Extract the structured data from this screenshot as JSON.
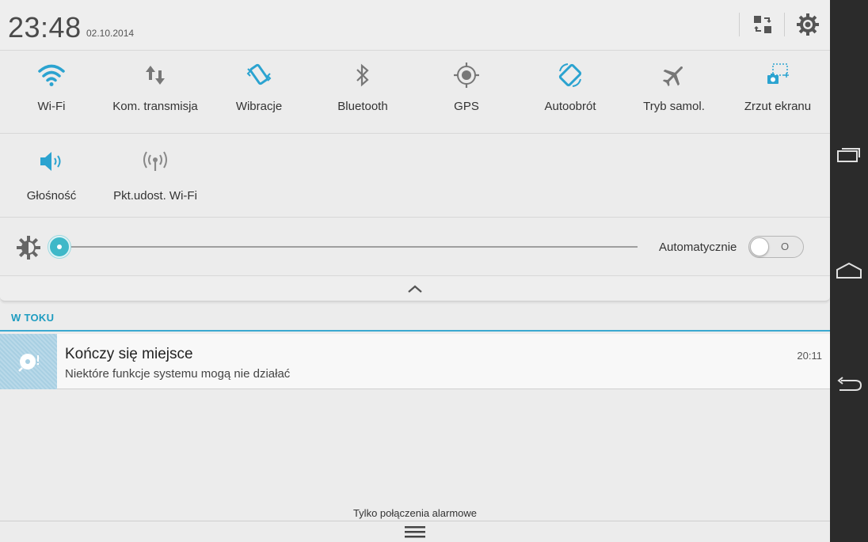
{
  "status": {
    "time": "23:48",
    "date": "02.10.2014"
  },
  "colors": {
    "accent": "#2ba3d0",
    "inactive_icon": "#8a8a8a",
    "navbar": "#2b2b2b"
  },
  "header_icons": [
    {
      "icon": "switch-user-icon"
    },
    {
      "icon": "settings-gear-icon"
    }
  ],
  "toggles_row1": [
    {
      "label": "Wi-Fi",
      "icon": "wifi-icon",
      "active": true
    },
    {
      "label": "Kom. transmisja",
      "icon": "data-transfer-icon",
      "active": false
    },
    {
      "label": "Wibracje",
      "icon": "vibration-icon",
      "active": true
    },
    {
      "label": "Bluetooth",
      "icon": "bluetooth-icon",
      "active": false
    },
    {
      "label": "GPS",
      "icon": "gps-icon",
      "active": false
    },
    {
      "label": "Autoobrót",
      "icon": "auto-rotate-icon",
      "active": true
    },
    {
      "label": "Tryb samol.",
      "icon": "airplane-icon",
      "active": false
    },
    {
      "label": "Zrzut ekranu",
      "icon": "screenshot-icon",
      "active": true
    }
  ],
  "toggles_row2": [
    {
      "label": "Głośność",
      "icon": "volume-icon",
      "active": true
    },
    {
      "label": "Pkt.udost. Wi-Fi",
      "icon": "hotspot-icon",
      "active": false
    }
  ],
  "brightness": {
    "level": 0.0,
    "auto_label": "Automatycznie",
    "auto_state": "O",
    "auto_on": false
  },
  "ongoing": {
    "section_title": "W TOKU",
    "notification": {
      "title": "Kończy się miejsce",
      "text": "Niektóre funkcje systemu mogą nie działać",
      "time": "20:11",
      "icon": "storage-warning-icon"
    }
  },
  "footer": {
    "text": "Tylko połączenia alarmowe"
  },
  "navbar": [
    {
      "icon": "recent-apps-icon"
    },
    {
      "icon": "home-icon"
    },
    {
      "icon": "back-icon"
    }
  ]
}
